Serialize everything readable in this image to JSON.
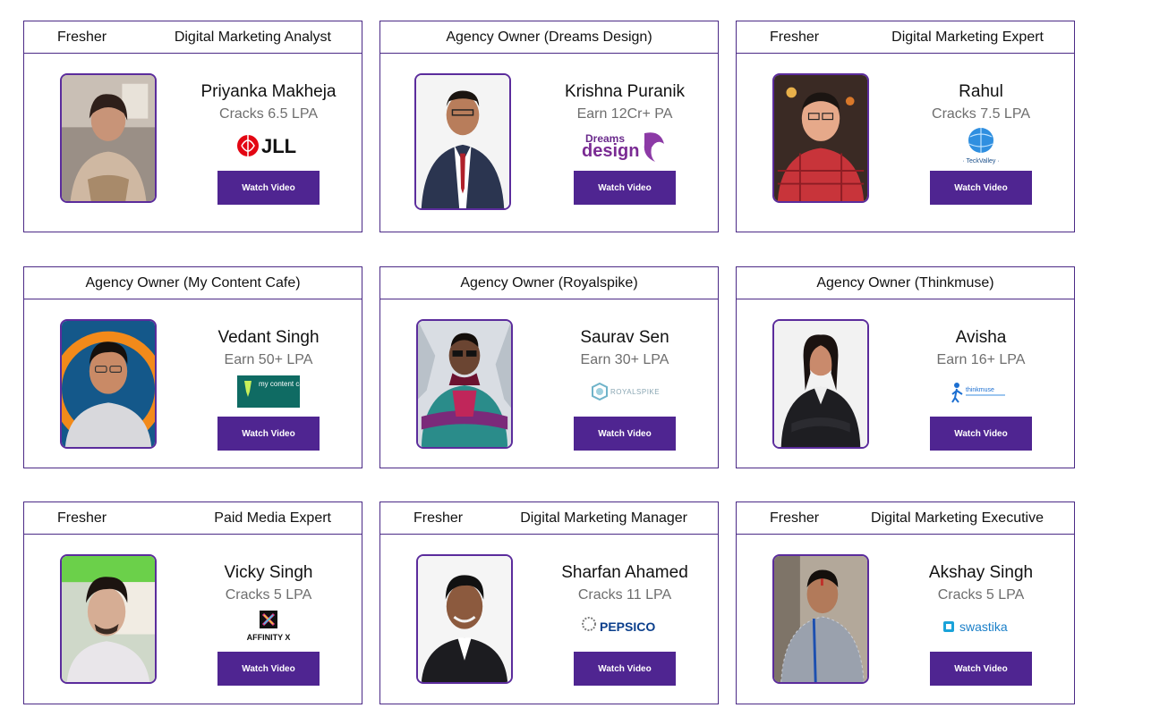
{
  "button_label": "Watch Video",
  "colors": {
    "border": "#4b2a86",
    "button": "#4f2591",
    "subtitle": "#6e6e6e"
  },
  "cards": [
    {
      "left": "Fresher",
      "right": "Digital Marketing Analyst",
      "name": "Priyanka Makheja",
      "earn": "Cracks 6.5 LPA",
      "logo_text": "JLL",
      "logo_icon": "jll-logo-icon"
    },
    {
      "center": "Agency Owner (Dreams Design)",
      "name": "Krishna Puranik",
      "earn": "Earn 12Cr+ PA",
      "logo_text": "Dreams design",
      "logo_icon": "dreams-design-logo-icon"
    },
    {
      "left": "Fresher",
      "right": "Digital Marketing Expert",
      "name": "Rahul",
      "earn": "Cracks 7.5 LPA",
      "logo_text": "TeckValley",
      "logo_icon": "teckvalley-logo-icon"
    },
    {
      "center": "Agency Owner (My Content Cafe)",
      "name": "Vedant Singh",
      "earn": "Earn 50+ LPA",
      "logo_text": "my content cafe",
      "logo_icon": "my-content-cafe-logo-icon"
    },
    {
      "center": "Agency Owner (Royalspike)",
      "name": "Saurav Sen",
      "earn": "Earn 30+ LPA",
      "logo_text": "ROYALSPIKE",
      "logo_icon": "royalspike-logo-icon"
    },
    {
      "center": "Agency Owner (Thinkmuse)",
      "name": "Avisha",
      "earn": "Earn 16+ LPA",
      "logo_text": "thinkmuse",
      "logo_icon": "thinkmuse-logo-icon"
    },
    {
      "left": "Fresher",
      "right": "Paid Media Expert",
      "name": "Vicky Singh",
      "earn": "Cracks 5 LPA",
      "logo_text": "AFFINITY X",
      "logo_icon": "affinity-x-logo-icon"
    },
    {
      "left": "Fresher",
      "right": "Digital Marketing Manager",
      "name": "Sharfan Ahamed",
      "earn": "Cracks 11 LPA",
      "logo_text": "PEPSICO",
      "logo_icon": "pepsico-logo-icon"
    },
    {
      "left": "Fresher",
      "right": "Digital Marketing Executive",
      "name": "Akshay Singh",
      "earn": "Cracks 5 LPA",
      "logo_text": "swastika",
      "logo_icon": "swastika-logo-icon"
    }
  ]
}
